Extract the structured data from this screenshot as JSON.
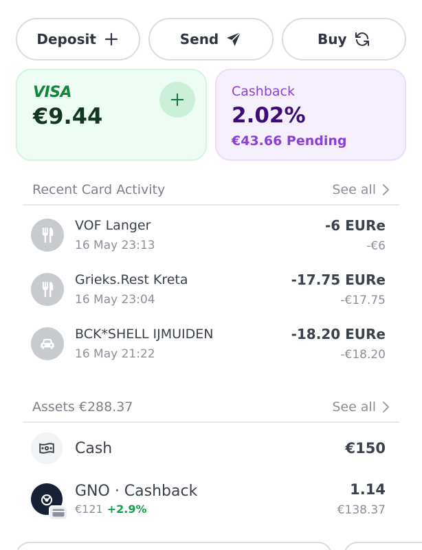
{
  "actions": [
    {
      "label": "Deposit",
      "icon": "plus-icon"
    },
    {
      "label": "Send",
      "icon": "send-icon"
    },
    {
      "label": "Buy",
      "icon": "refresh-icon"
    }
  ],
  "visa_card": {
    "brand": "VISA",
    "balance": "€9.44",
    "add_icon": "plus-icon"
  },
  "cashback_card": {
    "label": "Cashback",
    "rate": "2.02%",
    "pending": "€43.66 Pending"
  },
  "recent_activity": {
    "title": "Recent Card Activity",
    "see_all": "See all",
    "items": [
      {
        "name": "VOF Langer",
        "date": "16 May 23:13",
        "amount": "-6 EURe",
        "fiat": "-€6",
        "icon": "fork-knife-icon"
      },
      {
        "name": "Grieks.Rest Kreta",
        "date": "16 May 23:04",
        "amount": "-17.75 EURe",
        "fiat": "-€17.75",
        "icon": "fork-knife-icon"
      },
      {
        "name": "BCK*SHELL IJMUIDEN",
        "date": "16 May 21:22",
        "amount": "-18.20 EURe",
        "fiat": "-€18.20",
        "icon": "car-icon"
      }
    ]
  },
  "assets": {
    "title": "Assets €288.37",
    "see_all": "See all",
    "cash": {
      "name": "Cash",
      "value": "€150",
      "icon": "banknote-icon"
    },
    "gno": {
      "name": "GNO · Cashback",
      "price": "€121",
      "change": "+2.9%",
      "amount": "1.14",
      "fiat": "€138.37",
      "icon": "gnosis-icon"
    }
  },
  "colors": {
    "visa_green": "#12853c",
    "cashback_purple": "#8b3fd6",
    "positive": "#14a049"
  }
}
